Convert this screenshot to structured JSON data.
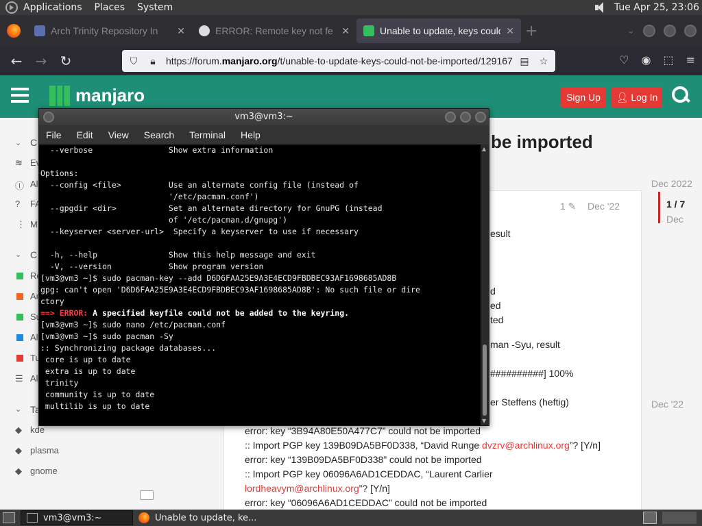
{
  "top_panel": {
    "menus": [
      "Applications",
      "Places",
      "System"
    ],
    "clock": "Tue Apr 25, 23:06"
  },
  "browser": {
    "tabs": [
      {
        "title": "Arch Trinity Repository In",
        "active": false
      },
      {
        "title": "ERROR: Remote key not fe",
        "active": false
      },
      {
        "title": "Unable to update, keys could",
        "active": true
      }
    ],
    "url_prefix": "https://forum.",
    "url_domain": "manjaro.org",
    "url_suffix": "/t/unable-to-update-keys-could-not-be-imported/129167"
  },
  "site": {
    "logo_text": "manjaro",
    "signup_label": "Sign Up",
    "login_label": "Log In",
    "brand_color": "#1e8e76",
    "accent_color": "#e53935"
  },
  "sidebar": {
    "sections": [
      "C",
      "C",
      "Ta"
    ],
    "items_top": [
      "Ev",
      "Al",
      "FA",
      "M"
    ],
    "categories": [
      "Re",
      "Ar",
      "Su",
      "Al",
      "Tu",
      "Al"
    ],
    "tags": [
      "kde",
      "plasma",
      "gnome"
    ]
  },
  "topic": {
    "title_visible": "be imported",
    "timeline_start": "Dec 2022",
    "timeline_pos": "1 / 7",
    "timeline_month": "Dec",
    "timeline_end": "Dec '22",
    "post_edits": "1",
    "post_date": "Dec '22",
    "partial_lines": [
      "esult",
      "d",
      "ed",
      "ted",
      "man -Syu, result",
      "##########] 100%",
      "er Steffens (heftig)"
    ],
    "lines": [
      {
        "text": "error: key “3B94A80E50A477C7” could not be imported"
      },
      {
        "pre": ":: Import PGP key 139B09DA5BF0D338, “David Runge ",
        "link": "dvzrv@archlinux.org",
        "post": "”? [Y/n]"
      },
      {
        "text": "error: key “139B09DA5BF0D338” could not be imported"
      },
      {
        "text": ":: Import PGP key 06096A6AD1CEDDAC, “Laurent Carlier"
      },
      {
        "pre": "",
        "link": "lordheavym@archlinux.org",
        "post": "”? [Y/n]"
      },
      {
        "text": "error: key “06096A6AD1CEDDAC” could not be imported"
      }
    ]
  },
  "terminal": {
    "title": "vm3@vm3:~",
    "menu": [
      "File",
      "Edit",
      "View",
      "Search",
      "Terminal",
      "Help"
    ],
    "lines": [
      {
        "t": "  --verbose                Show extra information",
        "c": ""
      },
      {
        "t": "",
        "c": ""
      },
      {
        "t": "Options:",
        "c": ""
      },
      {
        "t": "  --config <file>          Use an alternate config file (instead of",
        "c": ""
      },
      {
        "t": "                           '/etc/pacman.conf')",
        "c": ""
      },
      {
        "t": "  --gpgdir <dir>           Set an alternate directory for GnuPG (instead",
        "c": ""
      },
      {
        "t": "                           of '/etc/pacman.d/gnupg')",
        "c": ""
      },
      {
        "t": "  --keyserver <server-url>  Specify a keyserver to use if necessary",
        "c": ""
      },
      {
        "t": "",
        "c": ""
      },
      {
        "t": "  -h, --help               Show this help message and exit",
        "c": ""
      },
      {
        "t": "  -V, --version            Show program version",
        "c": ""
      },
      {
        "t": "[vm3@vm3 ~]$ sudo pacman-key --add D6D6FAA25E9A3E4ECD9FBDBEC93AF1698685AD8B",
        "c": ""
      },
      {
        "t": "gpg: can't open 'D6D6FAA25E9A3E4ECD9FBDBEC93AF1698685AD8B': No such file or dire",
        "c": ""
      },
      {
        "t": "ctory",
        "c": ""
      },
      {
        "t": "==> ERROR:",
        "c": "err",
        "rest": " A specified keyfile could not be added to the keyring."
      },
      {
        "t": "[vm3@vm3 ~]$ sudo nano /etc/pacman.conf",
        "c": ""
      },
      {
        "t": "[vm3@vm3 ~]$ sudo pacman -Sy",
        "c": ""
      },
      {
        "t": ":: Synchronizing package databases...",
        "c": ""
      },
      {
        "t": " core is up to date",
        "c": ""
      },
      {
        "t": " extra is up to date",
        "c": ""
      },
      {
        "t": " trinity",
        "c": ""
      },
      {
        "t": " community is up to date",
        "c": ""
      },
      {
        "t": " multilib is up to date",
        "c": ""
      }
    ]
  },
  "taskbar": {
    "tasks": [
      {
        "label": "vm3@vm3:~",
        "active": true
      },
      {
        "label": "Unable to update, ke...",
        "active": false
      }
    ]
  }
}
